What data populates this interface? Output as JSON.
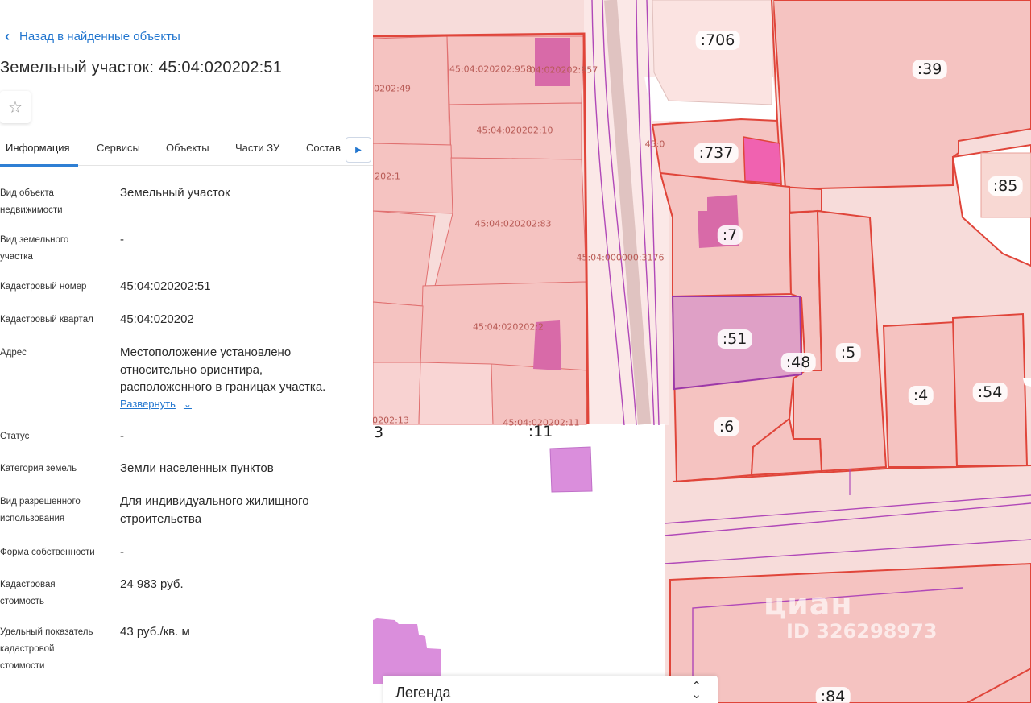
{
  "panel": {
    "back_link": "Назад в найденные объекты",
    "title": "Земельный участок: 45:04:020202:51",
    "tabs": [
      "Информация",
      "Сервисы",
      "Объекты",
      "Части ЗУ",
      "Состав"
    ],
    "active_tab": "Информация",
    "rows": [
      {
        "label": "Вид объекта\nнедвижимости",
        "value": "Земельный участок"
      },
      {
        "label": "Вид земельного\nучастка",
        "value": "-"
      },
      {
        "label": "Кадастровый номер",
        "value": "45:04:020202:51"
      },
      {
        "label": "Кадастровый квартал",
        "value": "45:04:020202"
      },
      {
        "label": "Адрес",
        "value": "Местоположение установлено\nотносительно ориентира,\nрасположенного в границах участка."
      },
      {
        "label": "Статус",
        "value": "-"
      },
      {
        "label": "Категория земель",
        "value": "Земли населенных пунктов"
      },
      {
        "label": "Вид разрешенного\nиспользования",
        "value": "Для индивидуального жилищного\nстроительства"
      },
      {
        "label": "Форма собственности",
        "value": "-"
      },
      {
        "label": "Кадастровая\nстоимость",
        "value": "24 983 руб."
      },
      {
        "label": "Удельный показатель\nкадастровой\nстоимости",
        "value": "43 руб./кв. м"
      }
    ],
    "expand_link": "Развернуть"
  },
  "map": {
    "plot_labels": [
      ":706",
      ":39",
      ":737",
      ":85",
      ":7",
      ":51",
      ":48",
      ":5",
      ":4",
      ":54",
      ":6",
      ":11",
      ":84",
      "3"
    ],
    "cadastral_labels": [
      "45:04:020202:958",
      "04:020202:957",
      "0202:49",
      "45:04:020202:10",
      "202:1",
      "45:04:020202:83",
      "45:04:000000:3176",
      "45:04:020202:2",
      "0202:13",
      "45:04:020202:11",
      "45:0"
    ],
    "watermark": "циан",
    "watermark_id": "ID 326298973"
  },
  "legend": {
    "label": "Легенда"
  },
  "colors": {
    "accent": "#2276cf",
    "plot_fill": "#f5c3c1",
    "plot_border": "#e0453a",
    "selected_plot": "#d998c4",
    "building": "#d86aa8",
    "purple_building": "#da8edc"
  }
}
